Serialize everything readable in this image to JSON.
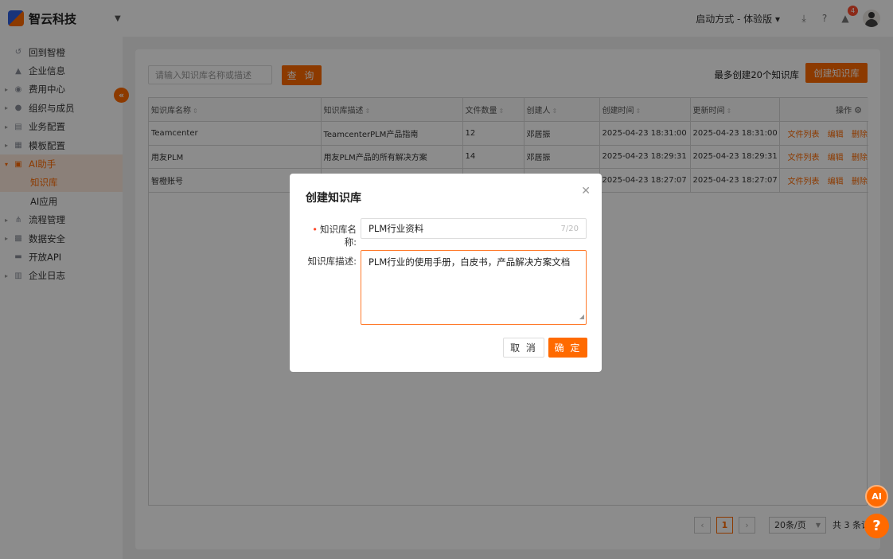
{
  "brand": {
    "name": "智云科技"
  },
  "header": {
    "mode_label": "启动方式 - 体验版",
    "notification_count": "4"
  },
  "sidebar": {
    "items": [
      {
        "label": "回到智橙",
        "icon": "back-icon"
      },
      {
        "label": "企业信息",
        "icon": "building-icon"
      },
      {
        "label": "费用中心",
        "icon": "coin-icon"
      },
      {
        "label": "组织与成员",
        "icon": "users-icon"
      },
      {
        "label": "业务配置",
        "icon": "business-icon"
      },
      {
        "label": "模板配置",
        "icon": "template-icon"
      },
      {
        "label": "AI助手",
        "icon": "robot-icon"
      },
      {
        "label": "知识库"
      },
      {
        "label": "AI应用"
      },
      {
        "label": "流程管理",
        "icon": "flow-icon"
      },
      {
        "label": "数据安全",
        "icon": "security-icon"
      },
      {
        "label": "开放API",
        "icon": "api-icon"
      },
      {
        "label": "企业日志",
        "icon": "log-icon"
      }
    ]
  },
  "toolbar": {
    "search_placeholder": "请输入知识库名称或描述",
    "query_label": "查 询",
    "limit_text": "最多创建20个知识库",
    "create_label": "创建知识库"
  },
  "table": {
    "columns": [
      "知识库名称",
      "知识库描述",
      "文件数量",
      "创建人",
      "创建时间",
      "更新时间",
      "操作"
    ],
    "rows": [
      [
        "Teamcenter",
        "TeamcenterPLM产品指南",
        "12",
        "邓居振",
        "2025-04-23 18:31:00",
        "2025-04-23 18:31:00"
      ],
      [
        "用友PLM",
        "用友PLM产品的所有解决方案",
        "14",
        "邓居振",
        "2025-04-23 18:29:31",
        "2025-04-23 18:29:31"
      ],
      [
        "智橙账号",
        "",
        "",
        "",
        "2025-04-23 18:27:07",
        "2025-04-23 18:27:07"
      ]
    ],
    "actions": [
      "文件列表",
      "编辑",
      "删除"
    ]
  },
  "pagination": {
    "current": "1",
    "page_size": "20条/页",
    "total": "共 3 条记录"
  },
  "modal": {
    "title": "创建知识库",
    "name_label": "知识库名称:",
    "name_value": "PLM行业资料",
    "name_count": "7/20",
    "desc_label": "知识库描述:",
    "desc_value": "PLM行业的使用手册，白皮书，产品解决方案文档",
    "cancel_label": "取 消",
    "ok_label": "确 定"
  },
  "colors": {
    "accent": "#ff6a00",
    "active_bg": "#fde9dc"
  }
}
